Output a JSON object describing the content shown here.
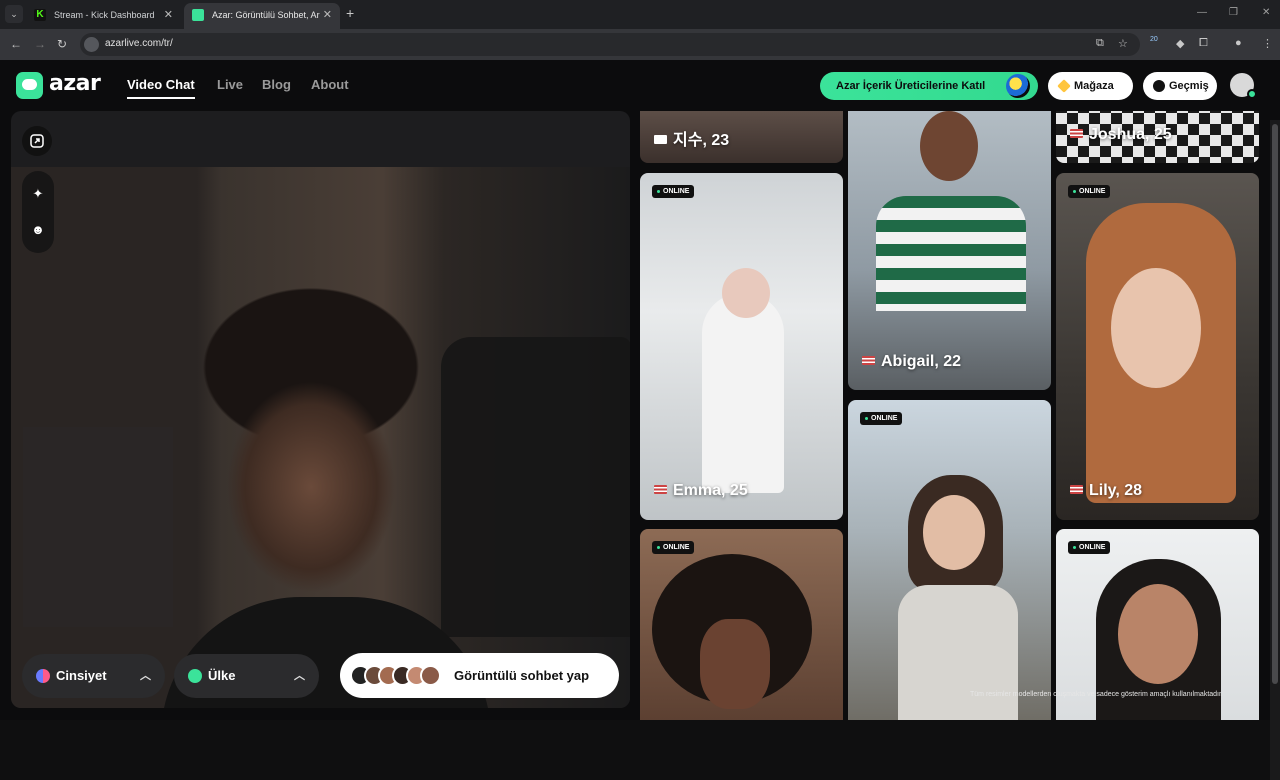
{
  "browser": {
    "tabs": [
      {
        "title": "Stream - Kick Dashboard",
        "active": false
      },
      {
        "title": "Azar: Görüntülü Sohbet, Ar",
        "active": true
      }
    ],
    "url": "azarlive.com/tr/",
    "extension_badge": "20"
  },
  "header": {
    "logo": "azar",
    "nav": [
      {
        "label": "Video Chat",
        "active": true
      },
      {
        "label": "Live",
        "active": false
      },
      {
        "label": "Blog",
        "active": false
      },
      {
        "label": "About",
        "active": false
      }
    ],
    "creator_cta": "Azar İçerik Üreticilerine Katıl",
    "store": "Mağaza",
    "history": "Geçmiş"
  },
  "video": {
    "filters": {
      "gender": "Cinsiyet",
      "country": "Ülke"
    },
    "start_button": "Görüntülü sohbet yap"
  },
  "grid": {
    "online_label": "ONLINE",
    "cards": [
      {
        "name": "지수, 23",
        "flag": "kr",
        "online": false
      },
      {
        "name": "Emma, 25",
        "flag": "us",
        "online": true
      },
      {
        "name": "",
        "flag": "",
        "online": true
      },
      {
        "name": "Abigail, 22",
        "flag": "us",
        "online": false
      },
      {
        "name": "",
        "flag": "",
        "online": true
      },
      {
        "name": "Joshua, 25",
        "flag": "us",
        "online": false
      },
      {
        "name": "Lily, 28",
        "flag": "us",
        "online": true
      },
      {
        "name": "",
        "flag": "",
        "online": true
      }
    ],
    "disclaimer": "Tüm resimler modellerden oluşmakta ve sadece gösterim amaçlı kullanılmaktadır."
  },
  "colors": {
    "accent": "#3be39a",
    "background": "#0c0c0d",
    "panel": "#1d1d1f"
  },
  "icons": [
    "tab-menu-icon",
    "kick-favicon",
    "azar-favicon",
    "back-icon",
    "forward-icon",
    "reload-icon",
    "site-info-icon",
    "install-icon",
    "star-icon",
    "extensions-icon",
    "profile-icon",
    "menu-icon",
    "expand-icon",
    "sparkle-icon",
    "face-effect-icon",
    "gender-icon",
    "country-icon",
    "chevron-up-icon",
    "gem-icon",
    "history-clock-icon",
    "user-avatar-icon"
  ]
}
